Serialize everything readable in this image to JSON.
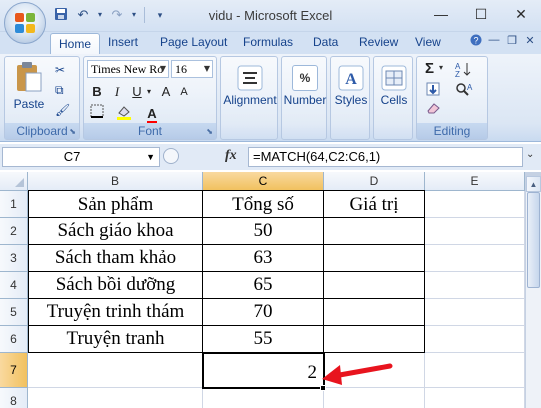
{
  "window": {
    "title": "vidu - Microsoft Excel",
    "minimize": "—",
    "restore": "☐",
    "close": "✕"
  },
  "qat": {
    "save_icon": "save-icon",
    "undo_icon": "undo-icon",
    "redo_icon": "redo-icon",
    "customize_icon": "dropdown-icon"
  },
  "tabs": [
    "Home",
    "Insert",
    "Page Layout",
    "Formulas",
    "Data",
    "Review",
    "View"
  ],
  "ribbon": {
    "clipboard": {
      "label": "Clipboard",
      "paste": "Paste"
    },
    "font": {
      "label": "Font",
      "font_name": "Times New Ro",
      "font_size": "16",
      "bold": "B",
      "italic": "I",
      "underline": "U",
      "grow": "A",
      "shrink": "A",
      "fill_color": "#ffff00",
      "font_color": "#ff0000"
    },
    "alignment": {
      "label": "Alignment"
    },
    "number": {
      "label": "Number",
      "glyph": "%"
    },
    "styles": {
      "label": "Styles"
    },
    "cells": {
      "label": "Cells"
    },
    "editing": {
      "label": "Editing",
      "sum": "Σ"
    }
  },
  "formula_bar": {
    "name_box": "C7",
    "fx": "fx",
    "formula": "=MATCH(64,C2:C6,1)"
  },
  "columns": [
    "B",
    "C",
    "D",
    "E"
  ],
  "rows": [
    "1",
    "2",
    "3",
    "4",
    "5",
    "6",
    "7",
    "8"
  ],
  "table": {
    "headers": [
      "Sản phẩm",
      "Tổng số",
      "Giá trị"
    ],
    "rows": [
      [
        "Sách giáo khoa",
        "50",
        ""
      ],
      [
        "Sách tham khảo",
        "63",
        ""
      ],
      [
        "Sách bồi dưỡng",
        "65",
        ""
      ],
      [
        "Truyện trinh thám",
        "70",
        ""
      ],
      [
        "Truyện tranh",
        "55",
        ""
      ]
    ],
    "result": "2"
  },
  "colors": {
    "selected_header": "#f1c15f",
    "arrow": "#e8141e"
  }
}
